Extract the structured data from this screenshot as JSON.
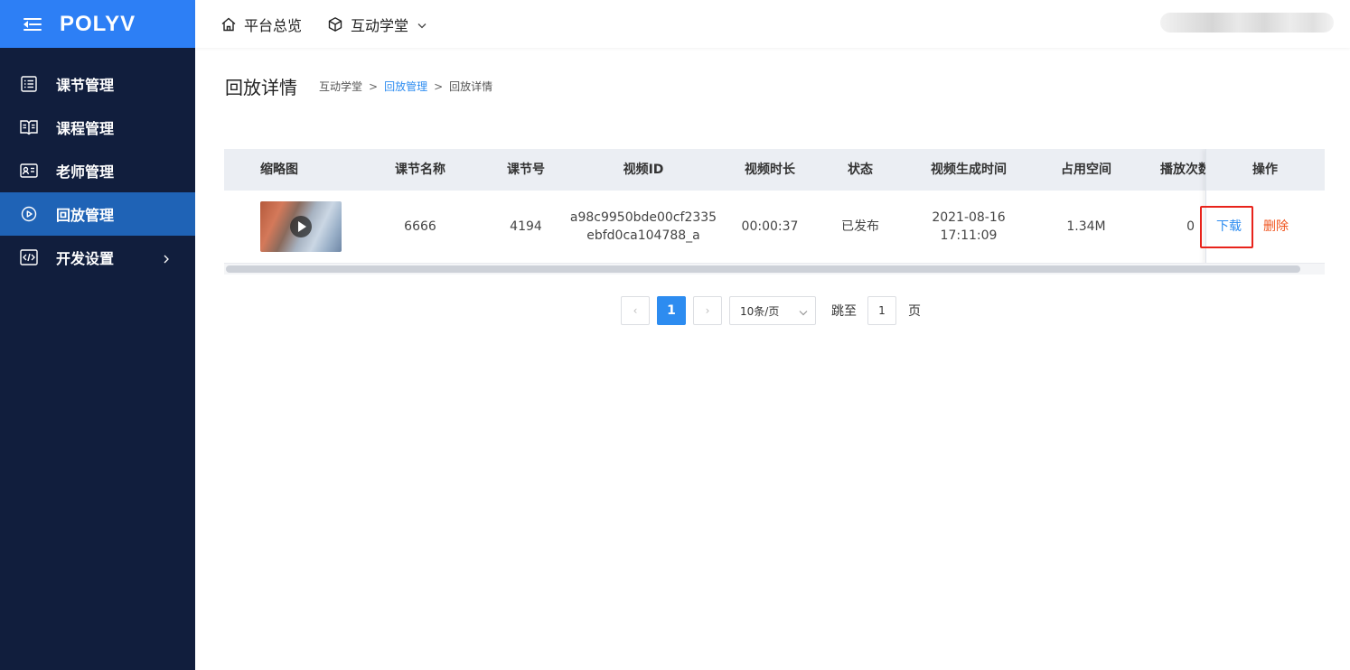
{
  "brand": {
    "logo": "POLYV",
    "accent": "#2d7ff5",
    "sidebar_bg": "#111e3d",
    "active_bg": "#1f63b6"
  },
  "sidebar": {
    "items": [
      {
        "label": "课节管理",
        "icon": "list-icon",
        "active": false
      },
      {
        "label": "课程管理",
        "icon": "book-icon",
        "active": false
      },
      {
        "label": "老师管理",
        "icon": "id-card-icon",
        "active": false
      },
      {
        "label": "回放管理",
        "icon": "play-circle-icon",
        "active": true
      },
      {
        "label": "开发设置",
        "icon": "code-icon",
        "active": false,
        "has_children": true
      }
    ]
  },
  "topbar": {
    "home_label": "平台总览",
    "school_label": "互动学堂"
  },
  "page": {
    "title": "回放详情",
    "breadcrumb": {
      "root": "互动学堂",
      "parent": "回放管理",
      "current": "回放详情",
      "separator": ">"
    }
  },
  "table": {
    "columns": {
      "thumbnail": "缩略图",
      "lesson_name": "课节名称",
      "lesson_no": "课节号",
      "video_id": "视频ID",
      "duration": "视频时长",
      "status": "状态",
      "created_time": "视频生成时间",
      "space": "占用空间",
      "play_count": "播放次数",
      "actions": "操作"
    },
    "rows": [
      {
        "lesson_name": "6666",
        "lesson_no": "4194",
        "video_id_line1": "a98c9950bde00cf2335",
        "video_id_line2": "ebfd0ca104788_a",
        "duration": "00:00:37",
        "status": "已发布",
        "created_date": "2021-08-16",
        "created_time": "17:11:09",
        "space": "1.34M",
        "play_count": "0",
        "download_label": "下载",
        "delete_label": "删除"
      }
    ]
  },
  "pagination": {
    "prev": "‹",
    "next": "›",
    "current_page": "1",
    "page_size": "10条/页",
    "jump_label": "跳至",
    "jump_value": "1",
    "page_suffix": "页"
  }
}
